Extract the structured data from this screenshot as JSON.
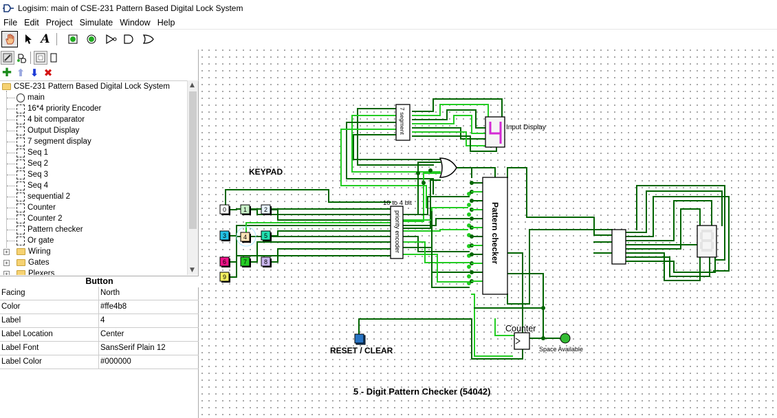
{
  "window": {
    "title": "Logisim: main of CSE-231 Pattern Based Digital Lock System"
  },
  "menu": [
    "File",
    "Edit",
    "Project",
    "Simulate",
    "Window",
    "Help"
  ],
  "toolbar_icons": [
    "poke-tool",
    "select-tool",
    "text-tool",
    "input-pin",
    "output-pin",
    "not-gate",
    "and-gate",
    "or-gate"
  ],
  "explorer": {
    "root": "CSE-231 Pattern Based Digital Lock System",
    "circuits": [
      "main",
      "16*4 priority Encoder",
      "4 bit comparator",
      "Output Display",
      "7 segment display",
      "Seq 1",
      "Seq 2",
      "Seq 3",
      "Seq 4",
      "sequential 2",
      "Counter",
      "Counter 2",
      "Pattern checker",
      "Or gate"
    ],
    "libraries": [
      "Wiring",
      "Gates",
      "Plexers"
    ]
  },
  "attributes": {
    "header": "Button",
    "rows": [
      {
        "name": "Facing",
        "value": "North"
      },
      {
        "name": "Color",
        "value": "#ffe4b8"
      },
      {
        "name": "Label",
        "value": "4"
      },
      {
        "name": "Label Location",
        "value": "Center"
      },
      {
        "name": "Label Font",
        "value": "SansSerif Plain 12"
      },
      {
        "name": "Label Color",
        "value": "#000000"
      }
    ]
  },
  "circuit": {
    "keypad_label": "KEYPAD",
    "keys": [
      {
        "label": "0",
        "color": "#ffffff"
      },
      {
        "label": "1",
        "color": "#c8f0c8"
      },
      {
        "label": "2",
        "color": "#e8f4ff"
      },
      {
        "label": "3",
        "color": "#22c1e6"
      },
      {
        "label": "4",
        "color": "#ffe4b8"
      },
      {
        "label": "5",
        "color": "#22e0b0"
      },
      {
        "label": "6",
        "color": "#ee1188"
      },
      {
        "label": "7",
        "color": "#22cc22"
      },
      {
        "label": "8",
        "color": "#cbb6f0"
      },
      {
        "label": "9",
        "color": "#f5f060"
      }
    ],
    "encoder_label": "10 to 4 bit",
    "encoder_body": "priority encoder",
    "seg_sub_label": "7 segment",
    "input_display_label": "Input Display",
    "pattern_checker_label": "Pattern checker",
    "counter_label": "Counter",
    "space_label": "Space Available",
    "reset_label": "RESET / CLEAR",
    "footer_title": "5 - Digit Pattern Checker (54042)",
    "colors": {
      "wire_dark": "#006400",
      "wire_bright": "#22cc22",
      "led_on": "#33bb33"
    }
  }
}
